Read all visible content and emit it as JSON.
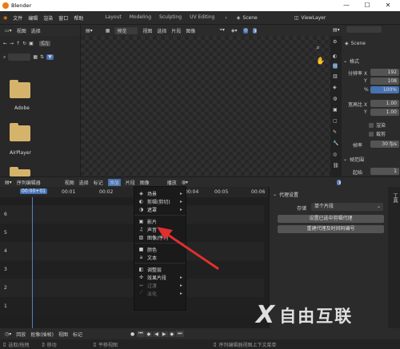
{
  "app": {
    "title": "Blender"
  },
  "window_controls": {
    "minimize": "—",
    "maximize": "☐",
    "close": "✕"
  },
  "menubar": {
    "items": [
      "文件",
      "编辑",
      "渲染",
      "窗口",
      "帮助"
    ],
    "workspaces": [
      "Layout",
      "Modeling",
      "Sculpting",
      "UV Editing"
    ],
    "scene": "Scene",
    "view_layer": "ViewLayer"
  },
  "file_browser": {
    "menus": [
      "视图",
      "选择"
    ],
    "path_label": "C:\\",
    "folders": [
      "Adobe",
      "AirPlayer"
    ]
  },
  "preview_header": {
    "mode": "预览",
    "menus": [
      "视图",
      "选择",
      "片段",
      "图像"
    ]
  },
  "properties": {
    "scene_label": "Scene",
    "format_section": "格式",
    "resolution_x_label": "分辨率 X",
    "resolution_x": "192",
    "resolution_y_label": "Y",
    "resolution_y": "108",
    "percent_label": "%",
    "percent": "100%",
    "aspect_x_label": "宽高比 X",
    "aspect_x": "1.00",
    "aspect_y_label": "Y",
    "aspect_y": "1.00",
    "render_region": "渲染",
    "crop": "裁剪",
    "frame_rate_label": "帧率",
    "frame_rate": "30 fps",
    "frame_range_section": "帧范围",
    "frame_start_label": "起始",
    "frame_start": "1"
  },
  "sequencer": {
    "editor_name": "序列编辑器",
    "menus": [
      "视图",
      "选择",
      "标记",
      "添加",
      "片段",
      "图像"
    ],
    "snap_label": "播放",
    "time_labels": [
      "00:00+01",
      "00:01",
      "00:02",
      "00:04",
      "00:05",
      "00:06"
    ],
    "channels": [
      "6",
      "5",
      "4",
      "3",
      "2",
      "1"
    ]
  },
  "add_menu": {
    "items": [
      {
        "label": "场景",
        "icon": "scene-icon",
        "glyph": "◈",
        "submenu": true,
        "enabled": true
      },
      {
        "label": "剪辑(剪切)",
        "icon": "movieclip-icon",
        "glyph": "◐",
        "submenu": true,
        "enabled": true
      },
      {
        "label": "遮罩",
        "icon": "mask-icon",
        "glyph": "◑",
        "submenu": true,
        "enabled": true
      },
      {
        "label": "影片",
        "icon": "film-icon",
        "glyph": "▣",
        "submenu": false,
        "enabled": true
      },
      {
        "label": "声音",
        "icon": "music-note-icon",
        "glyph": "♫",
        "submenu": false,
        "enabled": true
      },
      {
        "label": "图像/序列",
        "icon": "image-icon",
        "glyph": "▨",
        "submenu": false,
        "enabled": true
      },
      {
        "label": "颜色",
        "icon": "color-icon",
        "glyph": "■",
        "submenu": false,
        "enabled": true
      },
      {
        "label": "文本",
        "icon": "text-icon",
        "glyph": "a",
        "submenu": false,
        "enabled": true
      },
      {
        "label": "调整层",
        "icon": "adjustment-icon",
        "glyph": "◧",
        "submenu": false,
        "enabled": true
      },
      {
        "label": "效果片段",
        "icon": "effect-icon",
        "glyph": "✣",
        "submenu": true,
        "enabled": true
      },
      {
        "label": "过渡",
        "icon": "transition-icon",
        "glyph": "↔",
        "submenu": true,
        "enabled": false
      },
      {
        "label": "淡化",
        "icon": "fade-icon",
        "glyph": "⟋",
        "submenu": true,
        "enabled": false
      }
    ]
  },
  "proxy_panel": {
    "title": "代理设置",
    "storage_label": "存储",
    "storage_value": "单个片段",
    "set_button": "设置已选中剪辑代理",
    "rebuild_button": "重建代理及时间码编号"
  },
  "side_tab": {
    "label": "工具"
  },
  "timeline": {
    "menus": [
      "回放",
      "抠像(插帧)",
      "视图",
      "标记"
    ]
  },
  "statusbar": {
    "left": "选取/拖拽",
    "mid": "移动",
    "right_action": "平移视图",
    "hint": "序列编辑器视图上下文菜单"
  },
  "watermark": {
    "text": "自由互联"
  },
  "colors": {
    "accent": "#4772b3",
    "arrow": "#e0302e",
    "playhead": "#5680c2"
  }
}
